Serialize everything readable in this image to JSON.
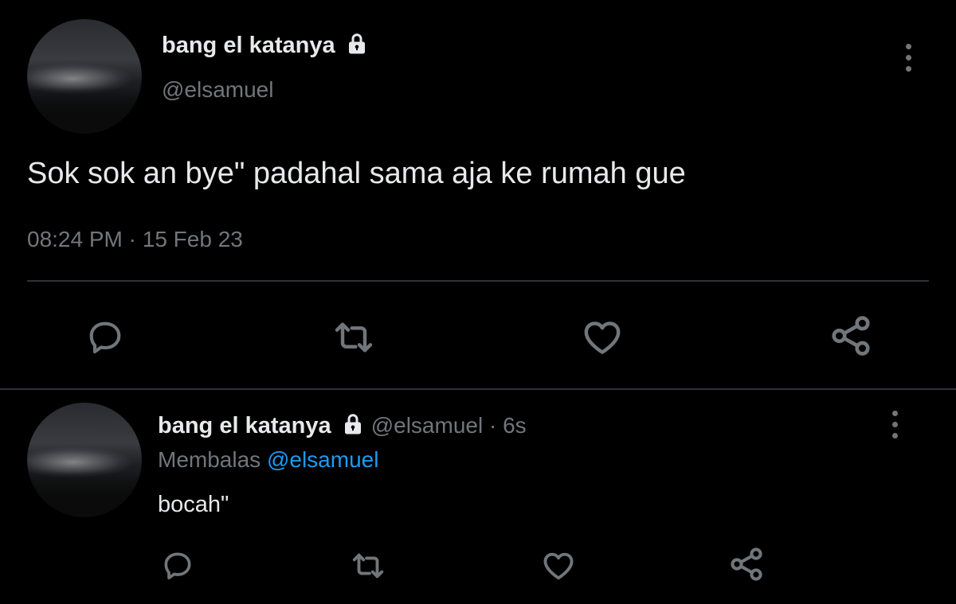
{
  "main_tweet": {
    "display_name": "bang el katanya",
    "handle": "@elsamuel",
    "text": "Sok sok an bye\" padahal sama aja ke rumah gue",
    "time": "08:24 PM",
    "separator": "·",
    "date": "15 Feb 23"
  },
  "reply_tweet": {
    "display_name": "bang el katanya",
    "handle": "@elsamuel",
    "separator": "·",
    "age": "6s",
    "replying_prefix": "Membalas",
    "replying_to": "@elsamuel",
    "text": "bocah\""
  },
  "icons": {
    "lock": "lock-icon",
    "more": "more-vertical-icon",
    "reply": "reply-icon",
    "retweet": "retweet-icon",
    "like": "heart-icon",
    "share": "share-icon"
  },
  "colors": {
    "background": "#000000",
    "primary_text": "#e7e9ea",
    "secondary_text": "#71767b",
    "link": "#1d9bf0",
    "divider": "#2f3336"
  }
}
